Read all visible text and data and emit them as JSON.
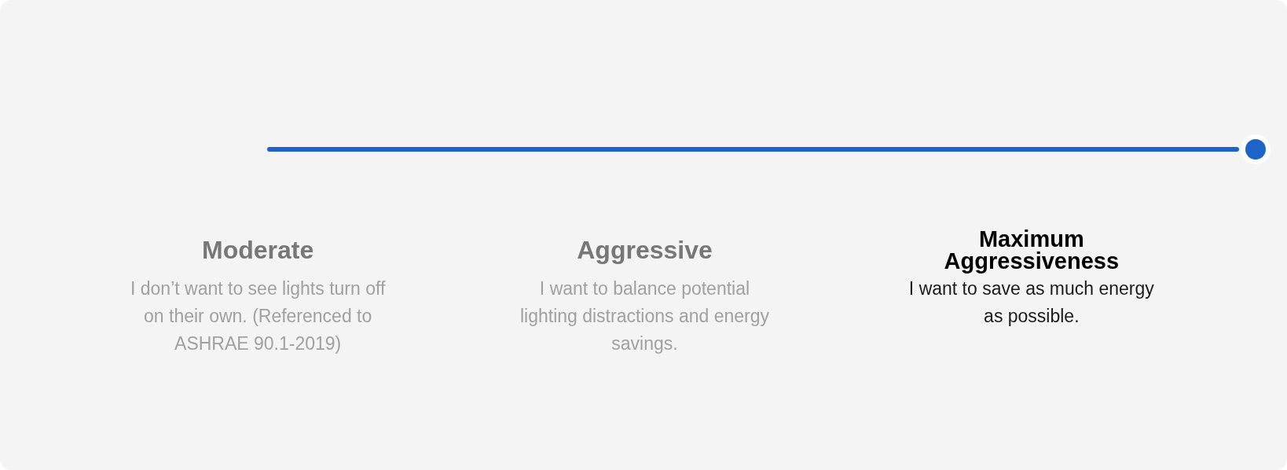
{
  "slider": {
    "level": 1
  },
  "options": [
    {
      "title": "Moderate",
      "description": "I don’t want to see lights turn off\non their own. (Referenced to\nASHRAE 90.1-2019)",
      "selected": false
    },
    {
      "title": "Aggressive",
      "description": "I want to balance potential\nlighting distractions and energy\nsavings.",
      "selected": false
    },
    {
      "title": "Maximum\nAggressiveness",
      "description": "I want to save as much energy\nas possible.",
      "selected": true
    }
  ]
}
